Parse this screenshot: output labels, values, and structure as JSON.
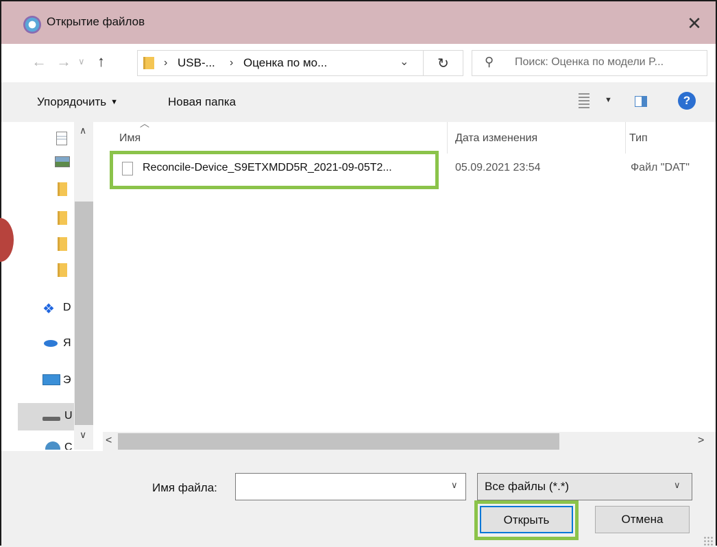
{
  "dialog": {
    "title": "Открытие файлов",
    "close_glyph": "✕"
  },
  "address": {
    "breadcrumbs": [
      "USB-...",
      "Оценка по мо..."
    ],
    "separator": "›",
    "search_placeholder": "Поиск: Оценка по модели P..."
  },
  "toolbar": {
    "organize_label": "Упорядочить",
    "new_folder_label": "Новая папка",
    "help_glyph": "?"
  },
  "nav_pane": {
    "items": [
      {
        "icon": "document-icon",
        "label": ""
      },
      {
        "icon": "picture-icon",
        "label": ""
      },
      {
        "icon": "folder-icon",
        "label": ""
      },
      {
        "icon": "folder-icon",
        "label": ""
      },
      {
        "icon": "folder-icon",
        "label": ""
      },
      {
        "icon": "folder-icon",
        "label": ""
      },
      {
        "icon": "dropbox-icon",
        "label": "D"
      },
      {
        "icon": "cloud-drive-icon",
        "label": "Я"
      },
      {
        "icon": "computer-icon",
        "label": "Э"
      },
      {
        "icon": "usb-drive-icon",
        "label": "U"
      },
      {
        "icon": "network-icon",
        "label": "C"
      }
    ]
  },
  "file_list": {
    "columns": {
      "name": "Имя",
      "date": "Дата изменения",
      "type": "Тип"
    },
    "rows": [
      {
        "name": "Reconcile-Device_S9ETXMDD5R_2021-09-05T2...",
        "date": "05.09.2021 23:54",
        "type": "Файл \"DAT\""
      }
    ]
  },
  "bottom": {
    "filename_label": "Имя файла:",
    "filename_value": "",
    "filetype_value": "Все файлы (*.*)",
    "open_label": "Открыть",
    "cancel_label": "Отмена"
  },
  "colors": {
    "titlebar": "#d6b6bb",
    "highlight": "#8bc34a",
    "accent": "#0078d7"
  }
}
